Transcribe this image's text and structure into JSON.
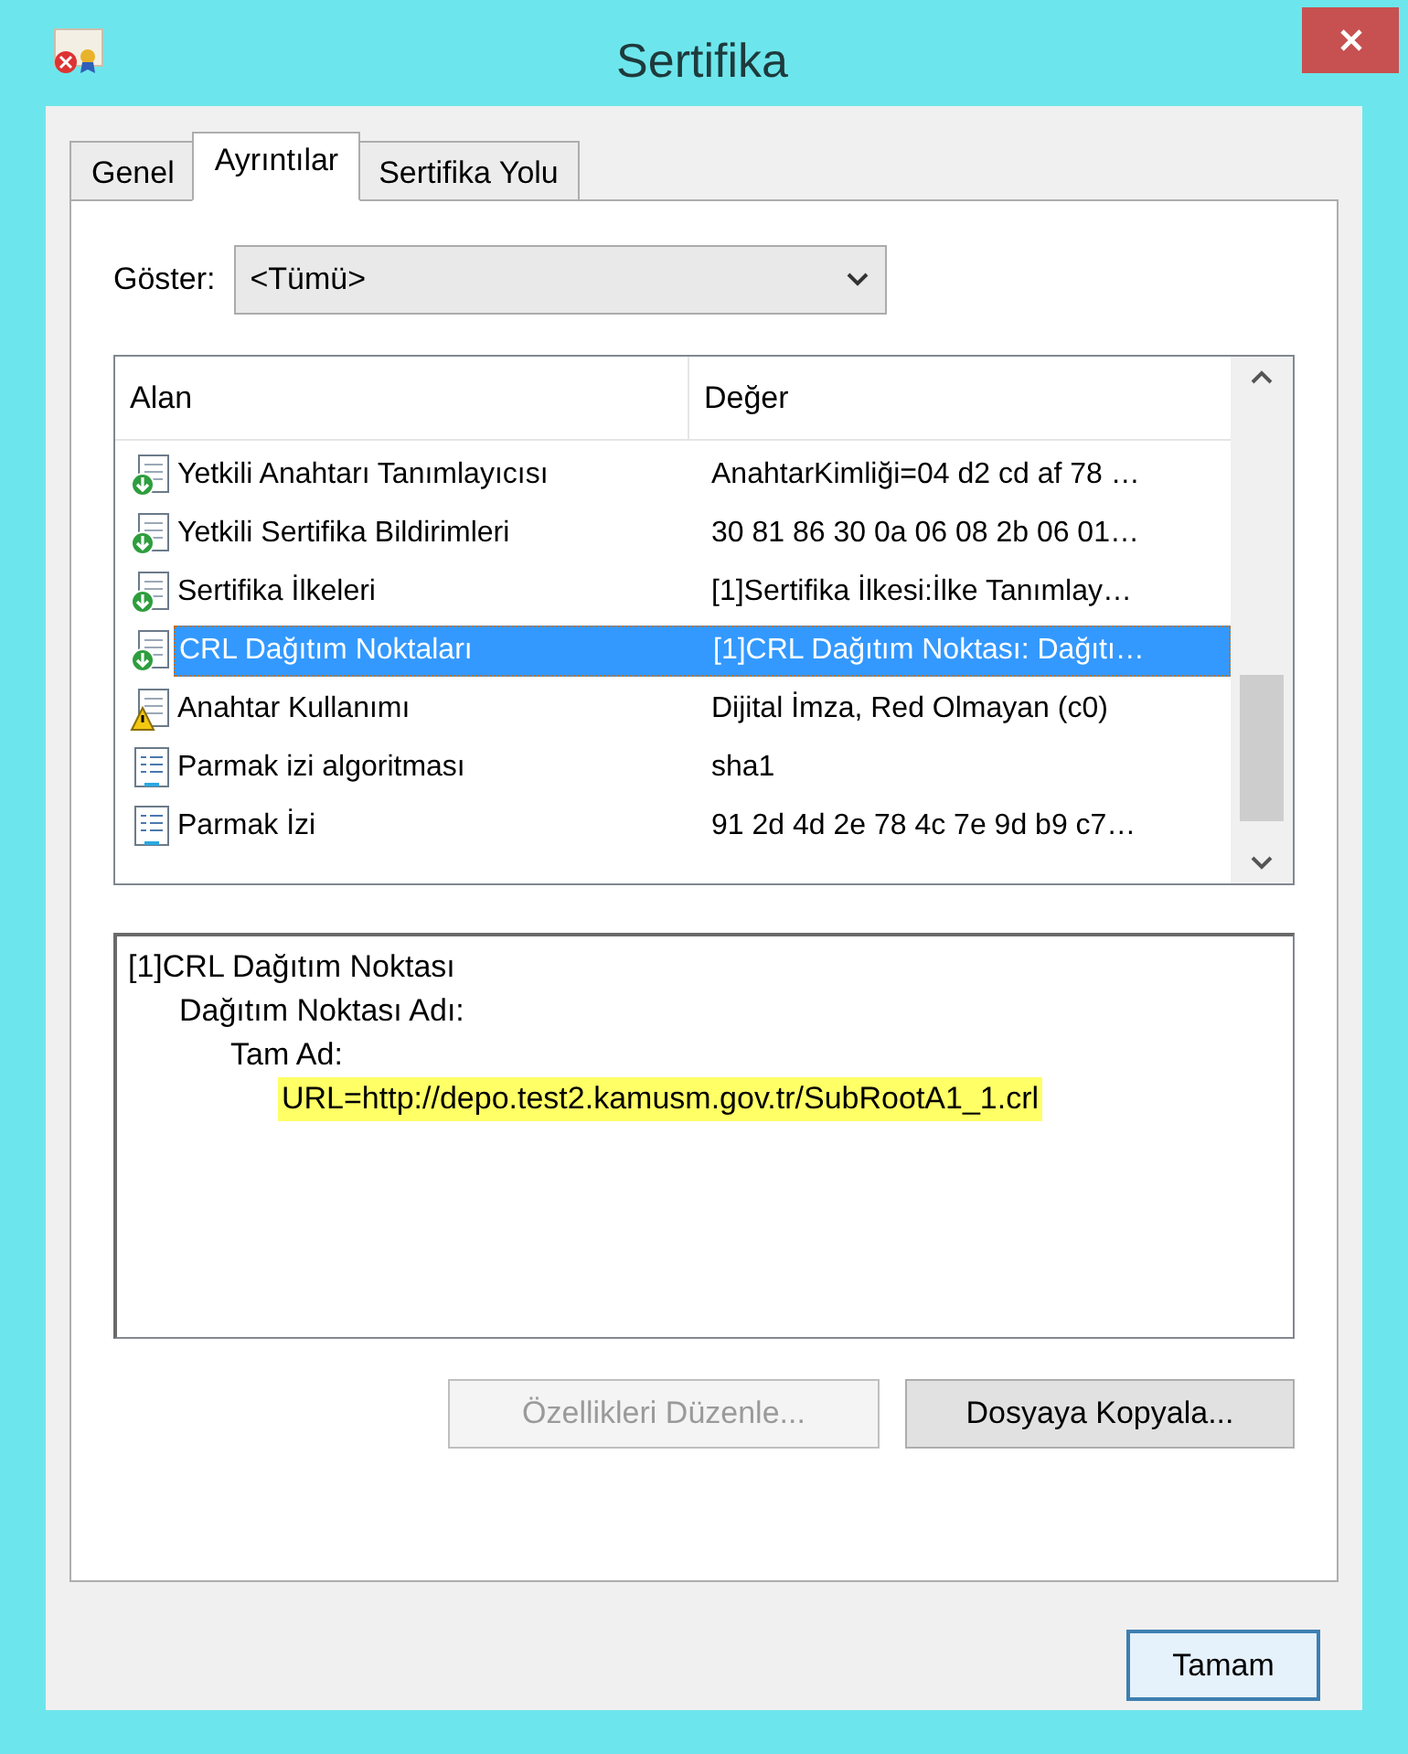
{
  "window": {
    "title": "Sertifika"
  },
  "tabs": [
    {
      "label": "Genel",
      "selected": false
    },
    {
      "label": "Ayrıntılar",
      "selected": true
    },
    {
      "label": "Sertifika Yolu",
      "selected": false
    }
  ],
  "show": {
    "label": "Göster:",
    "value": "<Tümü>"
  },
  "table": {
    "columns": [
      "Alan",
      "Değer"
    ],
    "rows": [
      {
        "kind": "extension",
        "field": "Yetkili Anahtarı Tanımlayıcısı",
        "value": "AnahtarKimliği=04 d2 cd af 78 …",
        "selected": false
      },
      {
        "kind": "extension",
        "field": "Yetkili Sertifika Bildirimleri",
        "value": "30 81 86 30 0a 06 08 2b 06 01…",
        "selected": false
      },
      {
        "kind": "extension",
        "field": "Sertifika İlkeleri",
        "value": "[1]Sertifika İlkesi:İlke Tanımlay…",
        "selected": false
      },
      {
        "kind": "extension",
        "field": "CRL Dağıtım Noktaları",
        "value": "[1]CRL Dağıtım Noktası: Dağıtı…",
        "selected": true
      },
      {
        "kind": "warning",
        "field": "Anahtar Kullanımı",
        "value": "Dijital İmza, Red Olmayan (c0)",
        "selected": false
      },
      {
        "kind": "property",
        "field": "Parmak izi algoritması",
        "value": "sha1",
        "selected": false
      },
      {
        "kind": "property",
        "field": "Parmak İzi",
        "value": "91 2d 4d 2e 78 4c 7e 9d b9 c7…",
        "selected": false
      }
    ]
  },
  "details": [
    {
      "text": "[1]CRL Dağıtım Noktası",
      "highlighted": false,
      "children": [
        {
          "text": "Dağıtım Noktası Adı:",
          "highlighted": false,
          "children": [
            {
              "text": "Tam Ad:",
              "highlighted": false,
              "children": [
                {
                  "text": "URL=http://depo.test2.kamusm.gov.tr/SubRootA1_1.crl",
                  "highlighted": true
                }
              ]
            }
          ]
        }
      ]
    }
  ],
  "buttons": [
    {
      "label": "Özellikleri Düzenle...",
      "disabled": true
    },
    {
      "label": "Dosyaya Kopyala...",
      "disabled": false
    }
  ],
  "footer_button": {
    "label": "Tamam"
  }
}
